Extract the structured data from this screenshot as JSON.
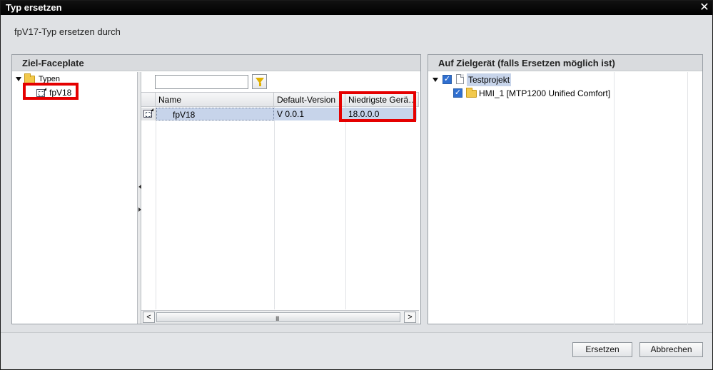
{
  "window": {
    "title": "Typ ersetzen",
    "close_glyph": "✕"
  },
  "dialog": {
    "heading": "fpV17-Typ ersetzen durch"
  },
  "left_panel": {
    "title": "Ziel-Faceplate",
    "tree": [
      {
        "label": "Typen",
        "icon": "folder-icon",
        "expanded": true
      },
      {
        "label": "fpV18",
        "icon": "faceplate-icon"
      }
    ],
    "search": {
      "value": "",
      "placeholder": ""
    },
    "grid": {
      "columns": [
        "Name",
        "Default-Version",
        "Niedrigste Gerä…"
      ],
      "rows": [
        {
          "name": "fpV18",
          "version": "V 0.0.1",
          "min_device": "18.0.0.0"
        }
      ]
    },
    "scroll_grip": "III",
    "scroll_left": "<",
    "scroll_right": ">"
  },
  "right_panel": {
    "title": "Auf Zielgerät (falls Ersetzen möglich ist)",
    "tree": [
      {
        "label": "Testprojekt",
        "checked": true,
        "icon": "document-icon"
      },
      {
        "label": "HMI_1 [MTP1200 Unified Comfort]",
        "checked": true,
        "icon": "folder-icon"
      }
    ]
  },
  "footer": {
    "replace_label": "Ersetzen",
    "cancel_label": "Abbrechen"
  },
  "colors": {
    "highlight": "#e50000",
    "selection": "#c7d4ea"
  }
}
